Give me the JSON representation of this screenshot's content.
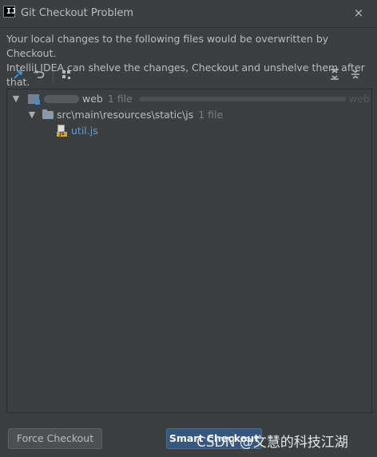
{
  "window": {
    "title": "Git Checkout Problem",
    "close_symbol": "×"
  },
  "message": {
    "line1": "Your local changes to the following files would be overwritten by Checkout.",
    "line2": "IntelliJ IDEA can shelve the changes, Checkout and unshelve them after that."
  },
  "toolbar": {
    "icons": [
      "pin-icon",
      "rollback-icon",
      "group-by-icon",
      "expand-all-icon",
      "collapse-all-icon"
    ]
  },
  "tree": {
    "module": {
      "name": "web",
      "count": "1 file",
      "tail": "web"
    },
    "folder": {
      "path": "src\\main\\resources\\static\\js",
      "count": "1 file"
    },
    "file": {
      "name": "util.js",
      "icon_tag": "JS"
    }
  },
  "buttons": {
    "force_checkout": "Force Checkout",
    "smart_checkout": "Smart Checkout"
  },
  "watermark": "CSDN @文慧的科技江湖",
  "colors": {
    "background": "#3c3f41",
    "text": "#bbbbbb",
    "file_link": "#5c9fd8",
    "primary_button": "#365880",
    "count_text": "#7a7e80"
  }
}
